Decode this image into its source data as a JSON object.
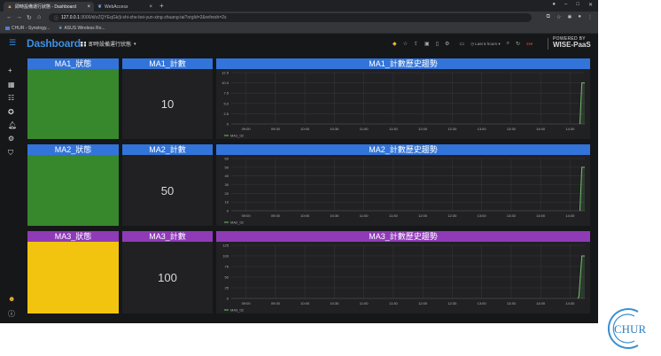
{
  "browser": {
    "tabs": [
      {
        "title": "即時設備運行狀態 - Dashboard",
        "active": true
      },
      {
        "title": "WebAccess",
        "active": false
      }
    ],
    "url_host": "127.0.0.1",
    "url_path": ":3000/d/zZQYEqGk/ji-shi-she-bei-yun-xing-zhuang-tai?orgId=2&refresh=2s",
    "bookmarks": [
      "CHUR - Synology...",
      "ASUS Wireless Ro..."
    ]
  },
  "header": {
    "brand": "Dashboard",
    "dashboard_name": "即時設備運行狀態",
    "time_range": "Last 6 hours",
    "refresh": "2s",
    "powered_line1": "POWERED BY",
    "powered_line2": "WISE-PaaS"
  },
  "colors": {
    "title_blue": "#3274d9",
    "title_purple": "#8f3bb8",
    "status_green": "#37872d",
    "status_yellow": "#f2c40f",
    "series": "#73bf69"
  },
  "rows": [
    {
      "status_title": "MA1_狀態",
      "count_title": "MA1_計數",
      "count_value": "10",
      "trend_title": "MA1_計數歷史趨勢",
      "status_color": "green",
      "title_color": "blue"
    },
    {
      "status_title": "MA2_狀態",
      "count_title": "MA2_計數",
      "count_value": "50",
      "trend_title": "MA2_計數歷史趨勢",
      "status_color": "green",
      "title_color": "blue"
    },
    {
      "status_title": "MA3_狀態",
      "count_title": "MA3_計數",
      "count_value": "100",
      "trend_title": "MA3_計數歷史趨勢",
      "status_color": "yellow",
      "title_color": "purple"
    }
  ],
  "chart_data": [
    {
      "type": "line",
      "x_ticks": [
        "09:00",
        "09:30",
        "10:00",
        "10:30",
        "11:00",
        "11:30",
        "12:00",
        "12:30",
        "13:00",
        "13:30",
        "14:00",
        "14:30"
      ],
      "y_ticks": [
        "0",
        "2.5",
        "5.0",
        "7.5",
        "10.0",
        "12.5"
      ],
      "ylim": [
        0,
        12.5
      ],
      "series": [
        {
          "name": "MA1_02",
          "points": [
            [
              "14:40",
              0
            ],
            [
              "14:42",
              10
            ],
            [
              "14:45",
              10
            ]
          ]
        }
      ],
      "legend": "bottom-left",
      "grid": true
    },
    {
      "type": "line",
      "x_ticks": [
        "09:00",
        "09:30",
        "10:00",
        "10:30",
        "11:00",
        "11:30",
        "12:00",
        "12:30",
        "13:00",
        "13:30",
        "14:00",
        "14:30"
      ],
      "y_ticks": [
        "0",
        "10",
        "20",
        "30",
        "40",
        "50",
        "60"
      ],
      "ylim": [
        0,
        60
      ],
      "series": [
        {
          "name": "MA2_02",
          "points": [
            [
              "14:40",
              0
            ],
            [
              "14:42",
              50
            ],
            [
              "14:45",
              50
            ]
          ]
        }
      ],
      "legend": "bottom-left",
      "grid": true
    },
    {
      "type": "line",
      "x_ticks": [
        "09:00",
        "09:30",
        "10:00",
        "10:30",
        "11:00",
        "11:30",
        "12:00",
        "12:30",
        "13:00",
        "13:30",
        "14:00",
        "14:30"
      ],
      "y_ticks": [
        "0",
        "25",
        "50",
        "75",
        "100",
        "125"
      ],
      "ylim": [
        0,
        125
      ],
      "series": [
        {
          "name": "MA3_02",
          "points": [
            [
              "14:38",
              0
            ],
            [
              "14:39",
              5
            ],
            [
              "14:42",
              100
            ],
            [
              "14:45",
              100
            ]
          ]
        }
      ],
      "legend": "bottom-left",
      "grid": true
    }
  ],
  "corner_logo": "CHUR"
}
